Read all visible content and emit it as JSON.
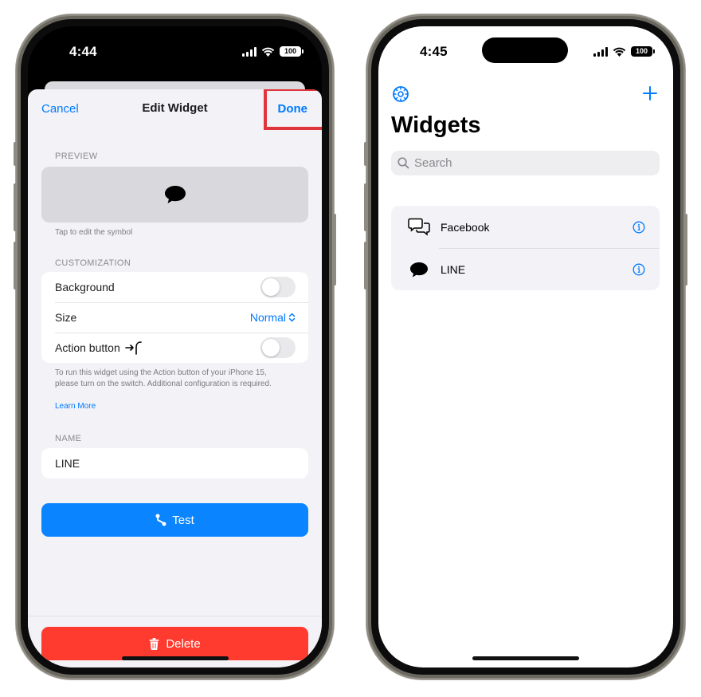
{
  "left_phone": {
    "status": {
      "time": "4:44",
      "battery": "100"
    },
    "nav": {
      "cancel": "Cancel",
      "title": "Edit Widget",
      "done": "Done"
    },
    "preview": {
      "section": "PREVIEW",
      "hint": "Tap to edit the symbol",
      "symbol": "speech-bubble-icon"
    },
    "customization": {
      "section": "CUSTOMIZATION",
      "background_label": "Background",
      "background_on": false,
      "size_label": "Size",
      "size_value": "Normal",
      "action_label": "Action button",
      "action_on": false
    },
    "footnote": "To run this widget using the Action button of your iPhone 15, please turn on the switch. Additional configuration is required.",
    "learn_more": "Learn More",
    "name": {
      "section": "NAME",
      "value": "LINE"
    },
    "test_label": "Test",
    "delete_label": "Delete",
    "colors": {
      "accent": "#007aff",
      "test_button": "#0a84ff",
      "delete_button": "#ff3b30",
      "highlight": "#e0353b"
    }
  },
  "right_phone": {
    "status": {
      "time": "4:45",
      "battery": "100"
    },
    "title": "Widgets",
    "search_placeholder": "Search",
    "items": [
      {
        "label": "Facebook",
        "icon": "two-speech-bubbles-icon"
      },
      {
        "label": "LINE",
        "icon": "speech-bubble-icon"
      }
    ]
  }
}
